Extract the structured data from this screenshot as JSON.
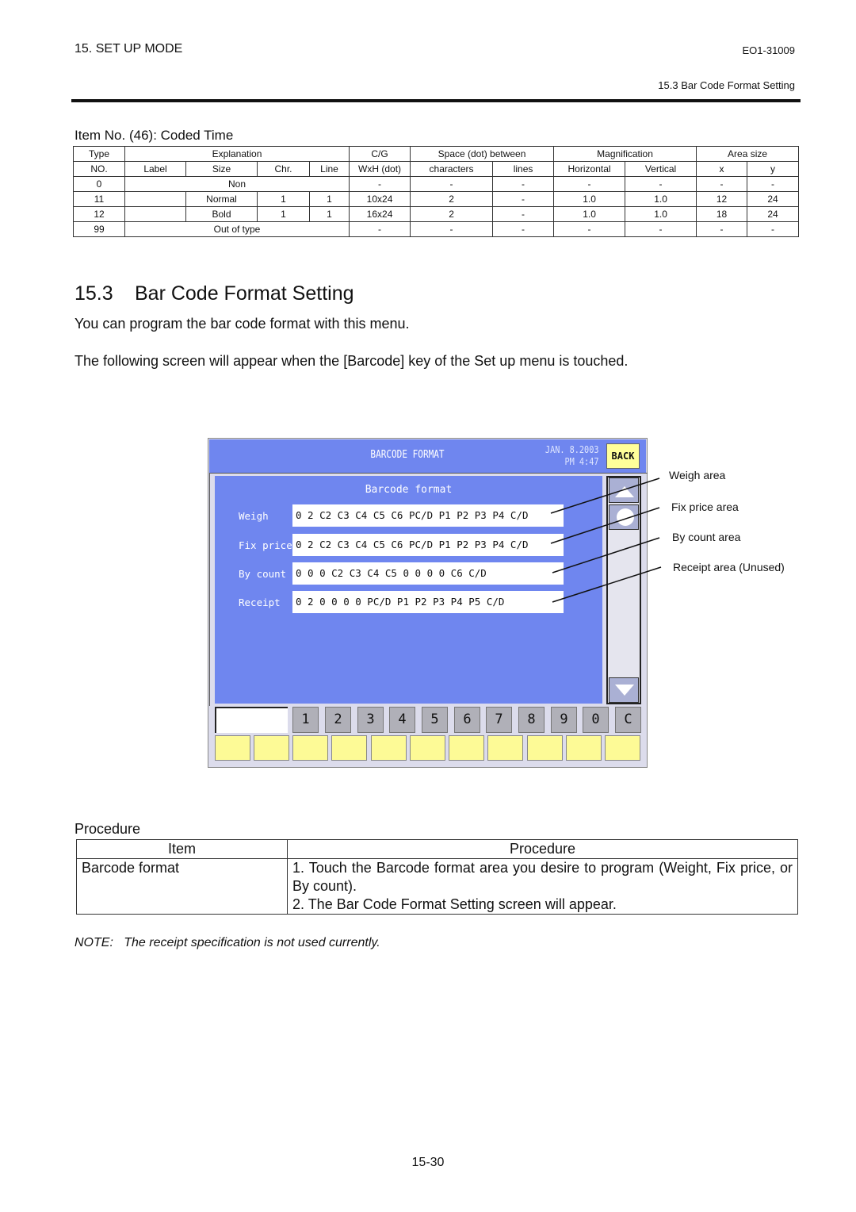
{
  "header": {
    "chapter": "15. SET UP MODE",
    "doc_code": "EO1-31009",
    "section_ref": "15.3 Bar Code Format Setting"
  },
  "coded_time": {
    "title": "Item No. (46): Coded Time",
    "header_row1": {
      "type": "Type",
      "explanation": "Explanation",
      "cg": "C/G",
      "space": "Space (dot) between",
      "magnification": "Magnification",
      "area_size": "Area size"
    },
    "header_row2": [
      "NO.",
      "Label",
      "Size",
      "Chr.",
      "Line",
      "WxH (dot)",
      "characters",
      "lines",
      "Horizontal",
      "Vertical",
      "x",
      "y"
    ],
    "rows": [
      {
        "no": "0",
        "explanation": "Non",
        "cg": "-",
        "chars": "-",
        "lines": "-",
        "horizontal": "-",
        "vertical": "-",
        "x": "-",
        "y": "-"
      },
      {
        "no": "11",
        "label": "",
        "size": "Normal",
        "chr": "1",
        "line": "1",
        "cg": "10x24",
        "chars": "2",
        "lines": "-",
        "horizontal": "1.0",
        "vertical": "1.0",
        "x": "12",
        "y": "24"
      },
      {
        "no": "12",
        "label": "",
        "size": "Bold",
        "chr": "1",
        "line": "1",
        "cg": "16x24",
        "chars": "2",
        "lines": "-",
        "horizontal": "1.0",
        "vertical": "1.0",
        "x": "18",
        "y": "24"
      },
      {
        "no": "99",
        "explanation": "Out of type",
        "cg": "-",
        "chars": "-",
        "lines": "-",
        "horizontal": "-",
        "vertical": "-",
        "x": "-",
        "y": "-"
      }
    ]
  },
  "section": {
    "number": "15.3",
    "title": "Bar Code Format Setting",
    "para1": "You can program the bar code format with this menu.",
    "para2": "The following screen will appear when the [Barcode]  key of the Set up menu is touched."
  },
  "screen": {
    "title": "BARCODE FORMAT",
    "date": "JAN. 8.2003",
    "time": "PM 4:47",
    "back_label": "BACK",
    "panel_title": "Barcode format",
    "rows": [
      {
        "label": "Weigh",
        "value": "0 2 C2 C3 C4 C5 C6 PC/D P1 P2 P3 P4 C/D"
      },
      {
        "label": "Fix price",
        "value": "0 2 C2 C3 C4 C5 C6 PC/D P1 P2 P3 P4 C/D"
      },
      {
        "label": "By count",
        "value": "0 0 0 C2 C3 C4 C5 0 0 0 0 C6 C/D"
      },
      {
        "label": "Receipt",
        "value": "0 2 0 0 0 0 PC/D P1 P2 P3 P4 P5 C/D"
      }
    ],
    "entry_value": "",
    "keys": [
      "1",
      "2",
      "3",
      "4",
      "5",
      "6",
      "7",
      "8",
      "9",
      "0",
      "C"
    ],
    "colors": {
      "panel": "#6f86ef",
      "function_key": "#fdfa96",
      "back": "#ffff9a"
    }
  },
  "callouts": [
    "Weigh area",
    "Fix price area",
    "By count area",
    "Receipt area (Unused)"
  ],
  "procedure": {
    "title": "Procedure",
    "col_item": "Item",
    "col_procedure": "Procedure",
    "item": "Barcode format",
    "step1": "1. Touch the Barcode format area you desire to program (Weight, Fix price, or By count).",
    "step2": "2. The Bar Code Format Setting screen will appear."
  },
  "note": "NOTE:   The receipt specification is not used currently.",
  "page_number": "15-30"
}
